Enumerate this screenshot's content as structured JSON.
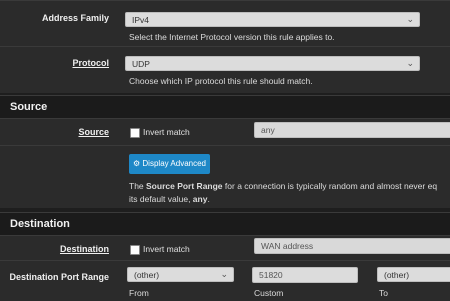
{
  "address_family": {
    "label": "Address Family",
    "value": "IPv4",
    "help": "Select the Internet Protocol version this rule applies to."
  },
  "protocol": {
    "label": "Protocol",
    "value": "UDP",
    "help": "Choose which IP protocol this rule should match."
  },
  "source": {
    "section_title": "Source",
    "label": "Source",
    "invert_label": "Invert match",
    "value": "any",
    "advanced_button": "Display Advanced",
    "help_line1_pre": "The ",
    "help_line1_bold": "Source Port Range",
    "help_line1_post": " for a connection is typically random and almost never eq",
    "help_line2_pre": "its default value, ",
    "help_line2_bold": "any",
    "help_line2_post": "."
  },
  "destination": {
    "section_title": "Destination",
    "label": "Destination",
    "invert_label": "Invert match",
    "value": "WAN address",
    "port_range_label": "Destination Port Range",
    "from_select": "(other)",
    "custom_value": "51820",
    "to_select": "(other)",
    "from_label": "From",
    "custom_label": "Custom",
    "to_label": "To"
  },
  "icons": {
    "chevron": "chevron-down-icon",
    "gear": "gear-icon"
  }
}
